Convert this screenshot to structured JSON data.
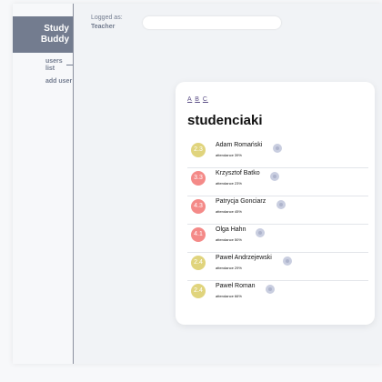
{
  "sidebar": {
    "logo_line1": "Study",
    "logo_line2": "Buddy",
    "nav_users_line1": "users",
    "nav_users_line2": "list",
    "nav_add_user": "add user"
  },
  "header": {
    "logged_as": "Logged as:",
    "role": "Teacher",
    "search_value": ""
  },
  "card": {
    "letters": [
      "A",
      "B",
      "C"
    ],
    "title": "studenciaki"
  },
  "colors": {
    "accent": "#737c8f",
    "grade_good": "#e0d47d",
    "grade_bad": "#f48a88"
  },
  "students": [
    {
      "grade": "2.3",
      "name": "Adam Romański",
      "attendance": "attendance 39%",
      "grade_color": "#e0d47d"
    },
    {
      "grade": "3.3",
      "name": "Krzysztof Batko",
      "attendance": "attendance 23%",
      "grade_color": "#f48a88"
    },
    {
      "grade": "4.3",
      "name": "Patrycja Gonciarz",
      "attendance": "attendance 45%",
      "grade_color": "#f48a88"
    },
    {
      "grade": "4.1",
      "name": "Olga Hahn",
      "attendance": "attendance 50%",
      "grade_color": "#f48a88"
    },
    {
      "grade": "2.4",
      "name": "Paweł Andrzejewski",
      "attendance": "attendance 29%",
      "grade_color": "#e0d47d"
    },
    {
      "grade": "2.4",
      "name": "Paweł Roman",
      "attendance": "attendance 66%",
      "grade_color": "#e0d47d"
    }
  ]
}
